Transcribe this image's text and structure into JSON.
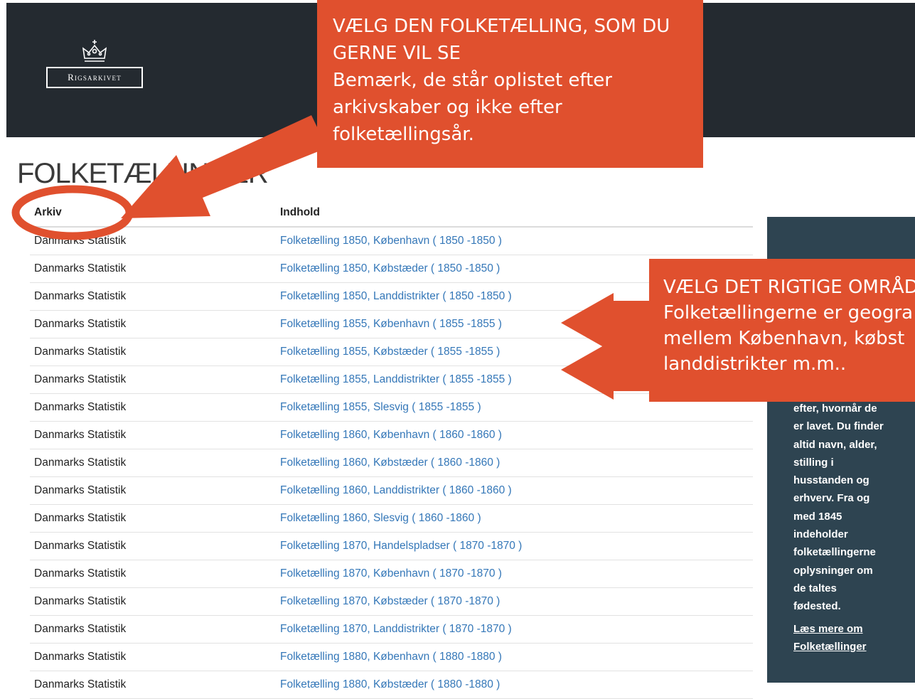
{
  "header": {
    "logo_text": "Rigsarkivet"
  },
  "page": {
    "title": "FOLKETÆLLINGER"
  },
  "table": {
    "headers": [
      "Arkiv",
      "Indhold"
    ],
    "rows": [
      {
        "arkiv": "Danmarks Statistik",
        "indhold": "Folketælling 1850, København ( 1850 -1850 )"
      },
      {
        "arkiv": "Danmarks Statistik",
        "indhold": "Folketælling 1850, Købstæder ( 1850 -1850 )"
      },
      {
        "arkiv": "Danmarks Statistik",
        "indhold": "Folketælling 1850, Landdistrikter ( 1850 -1850 )"
      },
      {
        "arkiv": "Danmarks Statistik",
        "indhold": "Folketælling 1855, København ( 1855 -1855 )"
      },
      {
        "arkiv": "Danmarks Statistik",
        "indhold": "Folketælling 1855, Købstæder ( 1855 -1855 )"
      },
      {
        "arkiv": "Danmarks Statistik",
        "indhold": "Folketælling 1855, Landdistrikter ( 1855 -1855 )"
      },
      {
        "arkiv": "Danmarks Statistik",
        "indhold": "Folketælling 1855, Slesvig ( 1855 -1855 )"
      },
      {
        "arkiv": "Danmarks Statistik",
        "indhold": "Folketælling 1860, København ( 1860 -1860 )"
      },
      {
        "arkiv": "Danmarks Statistik",
        "indhold": "Folketælling 1860, Købstæder ( 1860 -1860 )"
      },
      {
        "arkiv": "Danmarks Statistik",
        "indhold": "Folketælling 1860, Landdistrikter ( 1860 -1860 )"
      },
      {
        "arkiv": "Danmarks Statistik",
        "indhold": "Folketælling 1860, Slesvig ( 1860 -1860 )"
      },
      {
        "arkiv": "Danmarks Statistik",
        "indhold": "Folketælling 1870, Handelspladser ( 1870 -1870 )"
      },
      {
        "arkiv": "Danmarks Statistik",
        "indhold": "Folketælling 1870, København ( 1870 -1870 )"
      },
      {
        "arkiv": "Danmarks Statistik",
        "indhold": "Folketælling 1870, Købstæder ( 1870 -1870 )"
      },
      {
        "arkiv": "Danmarks Statistik",
        "indhold": "Folketælling 1870, Landdistrikter ( 1870 -1870 )"
      },
      {
        "arkiv": "Danmarks Statistik",
        "indhold": "Folketælling 1880, København ( 1880 -1880 )"
      },
      {
        "arkiv": "Danmarks Statistik",
        "indhold": "Folketælling 1880, Købstæder ( 1880 -1880 )"
      }
    ]
  },
  "sidebar": {
    "lines": [
      "efter, hvornår de",
      "er lavet. Du finder",
      "altid navn, alder,",
      "stilling i",
      "husstanden og",
      "erhverv. Fra og",
      "med 1845",
      "indeholder",
      "folketællingerne",
      "oplysninger om",
      "de taltes",
      "fødested."
    ],
    "link_lines": [
      "Læs mere om",
      "Folketællinger"
    ]
  },
  "callouts": {
    "first": {
      "lines": [
        "VÆLG DEN FOLKETÆLLING, SOM DU",
        "GERNE VIL SE",
        "Bemærk, de står oplistet efter",
        "arkivskaber og ikke efter",
        "folketællingsår."
      ]
    },
    "second": {
      "lines": [
        "VÆLG DET RIGTIGE OMRÅD",
        "Folketællingerne er geogra",
        "mellem København, købst",
        "landdistrikter m.m.."
      ]
    }
  },
  "colors": {
    "header_bg": "#242a30",
    "sidebar_bg": "#2e4451",
    "callout_bg": "#e0502e",
    "link": "#3477b8"
  }
}
